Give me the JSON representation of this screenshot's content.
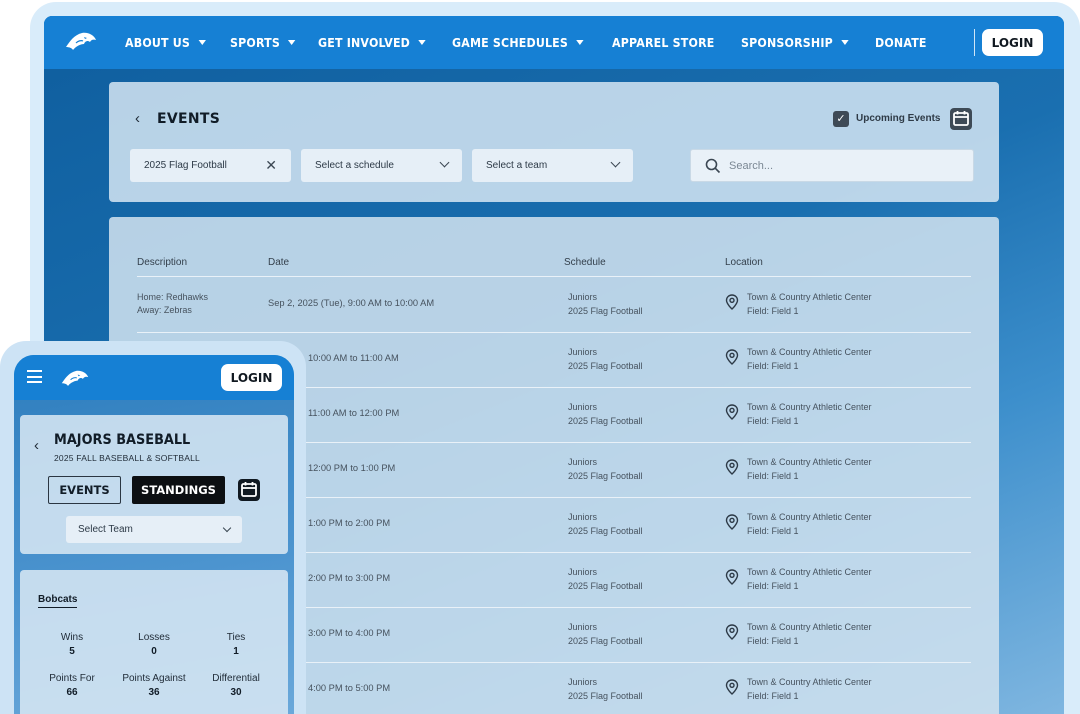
{
  "desktop": {
    "nav": {
      "items": [
        {
          "label": "ABOUT US",
          "has_dropdown": true
        },
        {
          "label": "SPORTS",
          "has_dropdown": true
        },
        {
          "label": "GET INVOLVED",
          "has_dropdown": true
        },
        {
          "label": "GAME SCHEDULES",
          "has_dropdown": true
        },
        {
          "label": "APPAREL STORE",
          "has_dropdown": false
        },
        {
          "label": "SPONSORSHIP",
          "has_dropdown": true
        },
        {
          "label": "DONATE",
          "has_dropdown": false
        }
      ],
      "login_label": "LOGIN"
    },
    "events_header": {
      "title": "EVENTS",
      "upcoming_label": "Upcoming Events",
      "upcoming_checked": true
    },
    "filters": {
      "program": "2025 Flag Football",
      "schedule_placeholder": "Select a schedule",
      "team_placeholder": "Select a team",
      "search_placeholder": "Search..."
    },
    "table": {
      "columns": [
        "Description",
        "Date",
        "Schedule",
        "Location"
      ],
      "rows": [
        {
          "description": [
            "Home: Redhawks",
            "Away: Zebras"
          ],
          "date": "Sep 2, 2025 (Tue), 9:00 AM to 10:00 AM",
          "schedule": [
            "Juniors",
            "2025 Flag Football"
          ],
          "location": [
            "Town & Country Athletic Center",
            "Field: Field 1"
          ]
        },
        {
          "description": [
            "",
            ""
          ],
          "date": "25 (Tue), 10:00 AM to 11:00 AM",
          "schedule": [
            "Juniors",
            "2025 Flag Football"
          ],
          "location": [
            "Town & Country Athletic Center",
            "Field: Field 1"
          ]
        },
        {
          "description": [
            "",
            ""
          ],
          "date": "25 (Tue), 11:00 AM to 12:00 PM",
          "schedule": [
            "Juniors",
            "2025 Flag Football"
          ],
          "location": [
            "Town & Country Athletic Center",
            "Field: Field 1"
          ]
        },
        {
          "description": [
            "",
            ""
          ],
          "date": "25 (Tue), 12:00 PM to 1:00 PM",
          "schedule": [
            "Juniors",
            "2025 Flag Football"
          ],
          "location": [
            "Town & Country Athletic Center",
            "Field: Field 1"
          ]
        },
        {
          "description": [
            "",
            ""
          ],
          "date": "25 (Tue), 1:00 PM to 2:00 PM",
          "schedule": [
            "Juniors",
            "2025 Flag Football"
          ],
          "location": [
            "Town & Country Athletic Center",
            "Field: Field 1"
          ]
        },
        {
          "description": [
            "",
            ""
          ],
          "date": "25 (Tue), 2:00 PM to 3:00 PM",
          "schedule": [
            "Juniors",
            "2025 Flag Football"
          ],
          "location": [
            "Town & Country Athletic Center",
            "Field: Field 1"
          ]
        },
        {
          "description": [
            "",
            ""
          ],
          "date": "25 (Tue), 3:00 PM to 4:00 PM",
          "schedule": [
            "Juniors",
            "2025 Flag Football"
          ],
          "location": [
            "Town & Country Athletic Center",
            "Field: Field 1"
          ]
        },
        {
          "description": [
            "",
            ""
          ],
          "date": "25 (Tue), 4:00 PM to 5:00 PM",
          "schedule": [
            "Juniors",
            "2025 Flag Football"
          ],
          "location": [
            "Town & Country Athletic Center",
            "Field: Field 1"
          ]
        }
      ]
    }
  },
  "mobile": {
    "login_label": "LOGIN",
    "title": "MAJORS BASEBALL",
    "subtitle": "2025 FALL BASEBALL & SOFTBALL",
    "tabs": {
      "events": "EVENTS",
      "standings": "STANDINGS",
      "active": "standings"
    },
    "team_select_placeholder": "Select Team",
    "team": "Bobcats",
    "stats": [
      {
        "label": "Wins",
        "value": "5"
      },
      {
        "label": "Losses",
        "value": "0"
      },
      {
        "label": "Ties",
        "value": "1"
      },
      {
        "label": "Points For",
        "value": "66"
      },
      {
        "label": "Points Against",
        "value": "36"
      },
      {
        "label": "Differential",
        "value": "30"
      }
    ]
  },
  "colors": {
    "nav_blue": "#1680d4",
    "page_blue": "#1a6fb0",
    "panel": "#d6e6f3",
    "active_tab": "#0c0f12"
  },
  "icons": [
    "bobcat-logo-icon",
    "chevron-down-icon",
    "back-arrow-icon",
    "checkbox-icon",
    "calendar-icon",
    "close-icon",
    "search-icon",
    "location-pin-icon",
    "hamburger-menu-icon"
  ]
}
